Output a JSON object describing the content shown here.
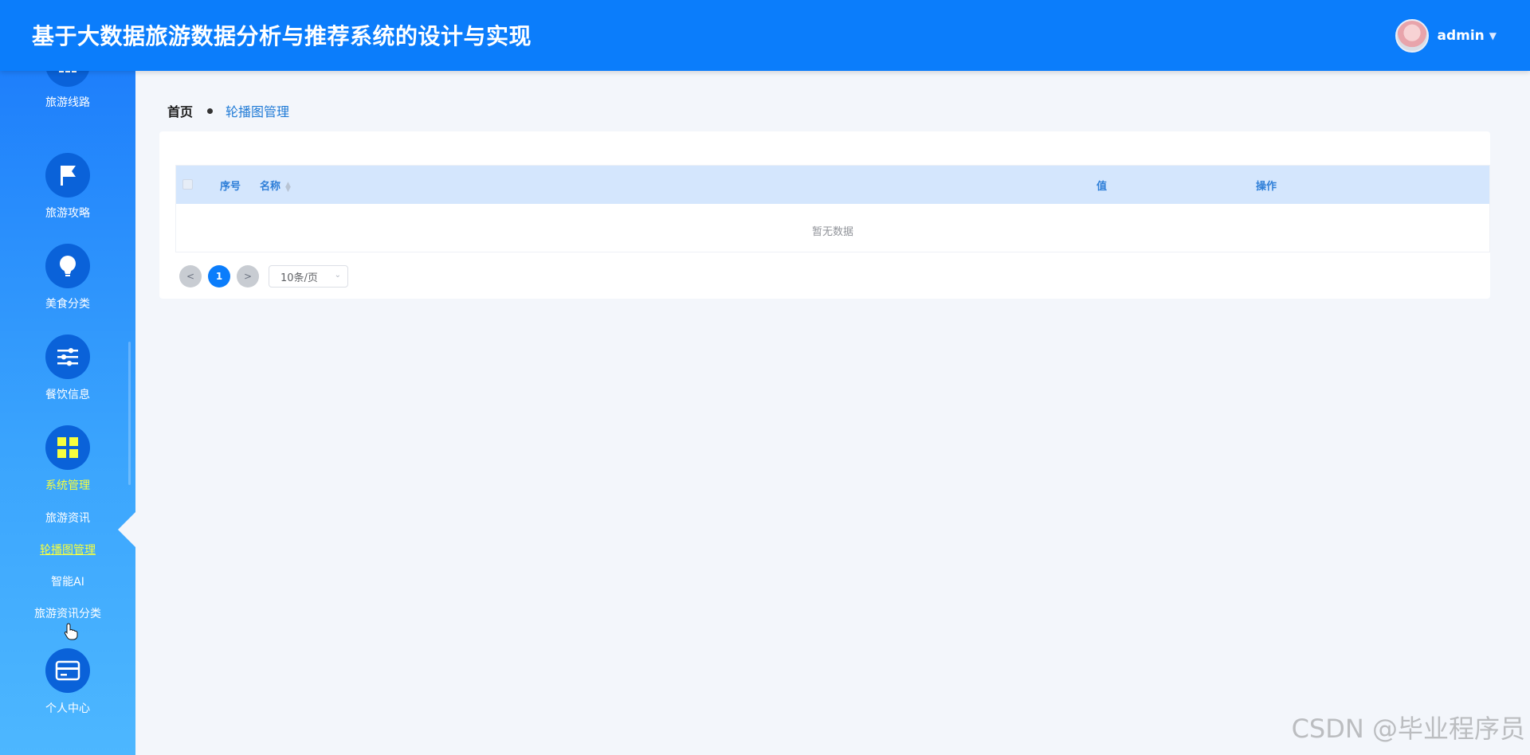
{
  "header": {
    "title": "基于大数据旅游数据分析与推荐系统的设计与实现",
    "username": "admin"
  },
  "sidebar": {
    "items": [
      {
        "label": "旅游线路",
        "icon": "dots-icon"
      },
      {
        "label": "旅游攻略",
        "icon": "flag-icon"
      },
      {
        "label": "美食分类",
        "icon": "lightbulb-icon"
      },
      {
        "label": "餐饮信息",
        "icon": "sliders-icon"
      },
      {
        "label": "系统管理",
        "icon": "grid-icon",
        "active": true
      },
      {
        "label": "个人中心",
        "icon": "card-icon"
      }
    ],
    "subitems": [
      {
        "label": "旅游资讯"
      },
      {
        "label": "轮播图管理",
        "active": true
      },
      {
        "label": "智能AI"
      },
      {
        "label": "旅游资讯分类"
      }
    ]
  },
  "breadcrumb": {
    "home": "首页",
    "current": "轮播图管理"
  },
  "table": {
    "columns": [
      "序号",
      "名称",
      "值",
      "操作"
    ],
    "empty_text": "暂无数据"
  },
  "pagination": {
    "prev": "<",
    "next": ">",
    "current_page": "1",
    "page_size": "10条/页"
  },
  "watermark": "CSDN @毕业程序员",
  "colors": {
    "header_bg": "#0b7dfb",
    "sidebar_top": "#1e7ffb",
    "sidebar_bottom": "#4db7ff",
    "menu_circle": "#0a62d9",
    "active_text": "#f7ff3d",
    "table_header": "#d4e6fd"
  }
}
